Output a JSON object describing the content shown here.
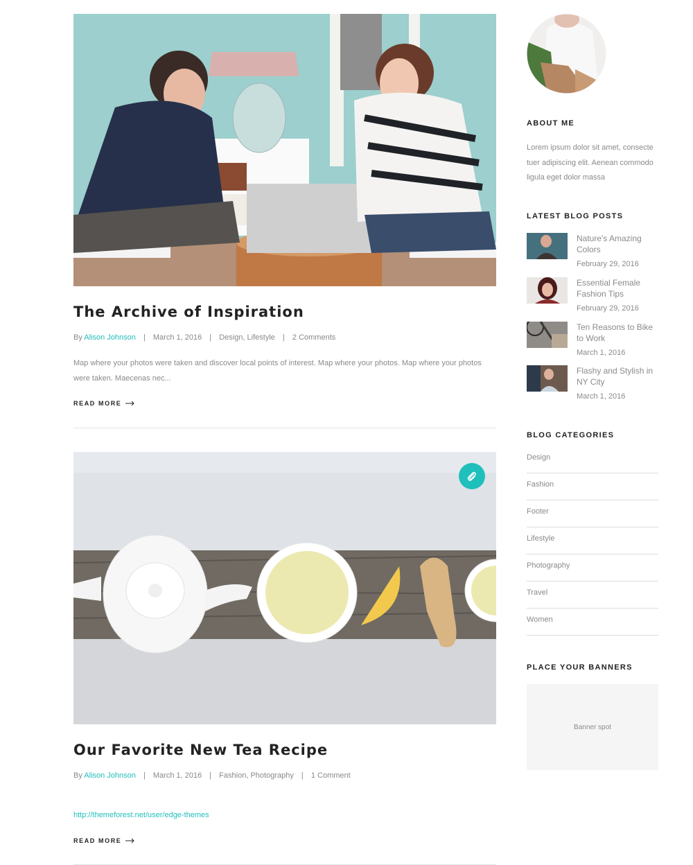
{
  "posts": [
    {
      "title": "The Archive of Inspiration",
      "by": "By",
      "author": "Alison Johnson",
      "date": "March 1, 2016",
      "categories": "Design, Lifestyle",
      "comments": "2 Comments",
      "excerpt": "Map where your photos were taken and discover local points of interest. Map where your photos. Map where your photos were taken. Maecenas nec...",
      "read_more": "READ MORE"
    },
    {
      "title": "Our Favorite New Tea Recipe",
      "by": "By",
      "author": "Alison Johnson",
      "date": "March 1, 2016",
      "categories": "Fashion, Photography",
      "comments": "1 Comment",
      "link": "http://themeforest.net/user/edge-themes",
      "read_more": "READ MORE",
      "format_icon": "paperclip-icon"
    }
  ],
  "sidebar": {
    "about": {
      "title": "ABOUT ME",
      "text": "Lorem ipsum dolor sit amet, consectetuer adipiscing elit. Aenean commodo ligula eget dolor massa"
    },
    "latest": {
      "title": "LATEST BLOG POSTS",
      "items": [
        {
          "title": "Nature's Amazing Colors",
          "date": "February 29, 2016"
        },
        {
          "title": "Essential Female Fashion Tips",
          "date": "February 29, 2016"
        },
        {
          "title": "Ten Reasons to Bike to Work",
          "date": "March 1, 2016"
        },
        {
          "title": "Flashy and Stylish in NY City",
          "date": "March 1, 2016"
        }
      ]
    },
    "categories": {
      "title": "BLOG CATEGORIES",
      "items": [
        "Design",
        "Fashion",
        "Footer",
        "Lifestyle",
        "Photography",
        "Travel",
        "Women"
      ]
    },
    "banners": {
      "title": "PLACE YOUR BANNERS",
      "spot": "Banner spot"
    }
  },
  "colors": {
    "accent": "#1fbfbb",
    "heading": "#222222",
    "muted": "#8a8a8a",
    "divider": "#e2e2e2"
  }
}
